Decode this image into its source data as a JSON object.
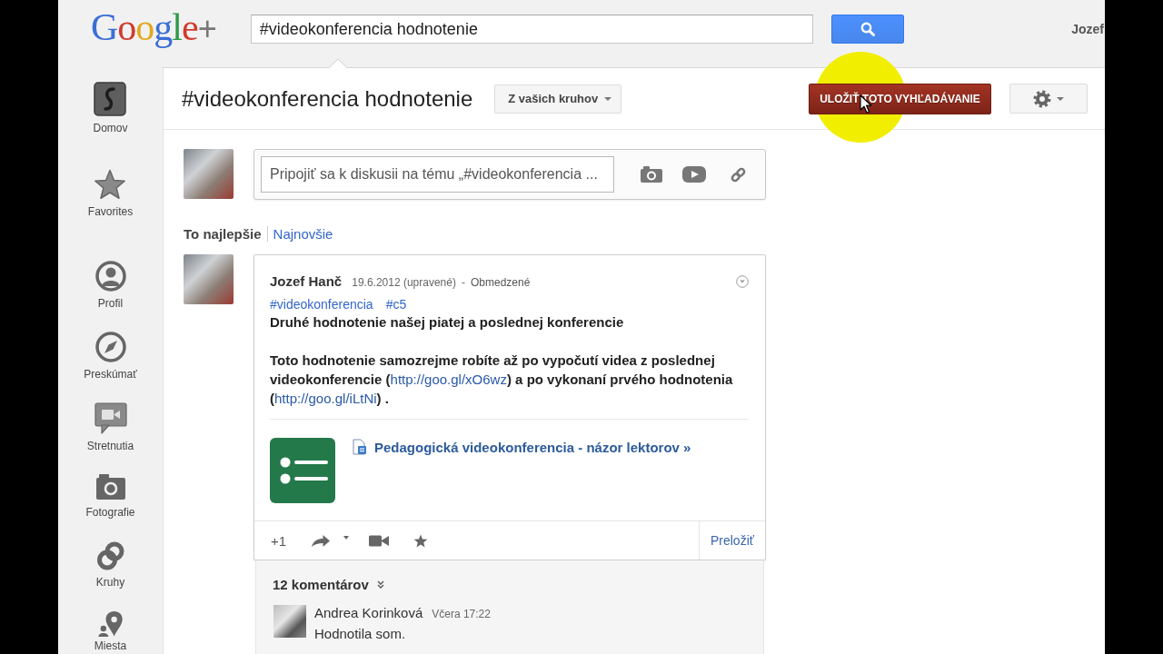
{
  "header": {
    "logo": "Google+",
    "search": {
      "value": "#videokonferencia hodnotenie"
    },
    "user_name": "Jozef"
  },
  "sidebar": {
    "items": [
      {
        "label": "Domov"
      },
      {
        "label": "Favorites"
      },
      {
        "label": "Profil"
      },
      {
        "label": "Preskúmať"
      },
      {
        "label": "Stretnutia"
      },
      {
        "label": "Fotografie"
      },
      {
        "label": "Kruhy"
      },
      {
        "label": "Miesta"
      }
    ]
  },
  "title_bar": {
    "title": "#videokonferencia hodnotenie",
    "filter": "Z vašich kruhov",
    "save_button": "ULOŽIŤ TOTO VYHĽADÁVANIE"
  },
  "compose": {
    "placeholder": "Pripojiť sa k diskusii na tému „#videokonferencia ..."
  },
  "sort_tabs": [
    {
      "label": "To najlepšie",
      "selected": true
    },
    {
      "label": "Najnovšie",
      "selected": false
    }
  ],
  "post": {
    "author": "Jozef Hanč",
    "date": "19.6.2012 (upravené)",
    "separator": "-",
    "visibility": "Obmedzené",
    "hashtags": [
      "#videokonferencia",
      "#c5"
    ],
    "title": "Druhé hodnotenie našej piatej a poslednej konferencie",
    "body": [
      {
        "kind": "text",
        "text": "Toto hodnotenie samozrejme robíte až po vypočutí videa z poslednej videokonferencie ("
      },
      {
        "kind": "link",
        "text": "http://goo.gl/xO6wz"
      },
      {
        "kind": "text",
        "text": ") a po vykonaní prvého hodnotenia ("
      },
      {
        "kind": "link",
        "text": "http://goo.gl/iLtNi"
      },
      {
        "kind": "text",
        "text": ") ."
      }
    ],
    "attachment": {
      "title": "Pedagogická videokonferencia - názor lektorov »"
    },
    "actions": {
      "plus_one": "+1",
      "translate": "Preložiť"
    }
  },
  "comments": {
    "count": "12 komentárov",
    "items": [
      {
        "author": "Andrea Korinková",
        "time": "Včera 17:22",
        "text": "Hodnotila som."
      }
    ]
  }
}
